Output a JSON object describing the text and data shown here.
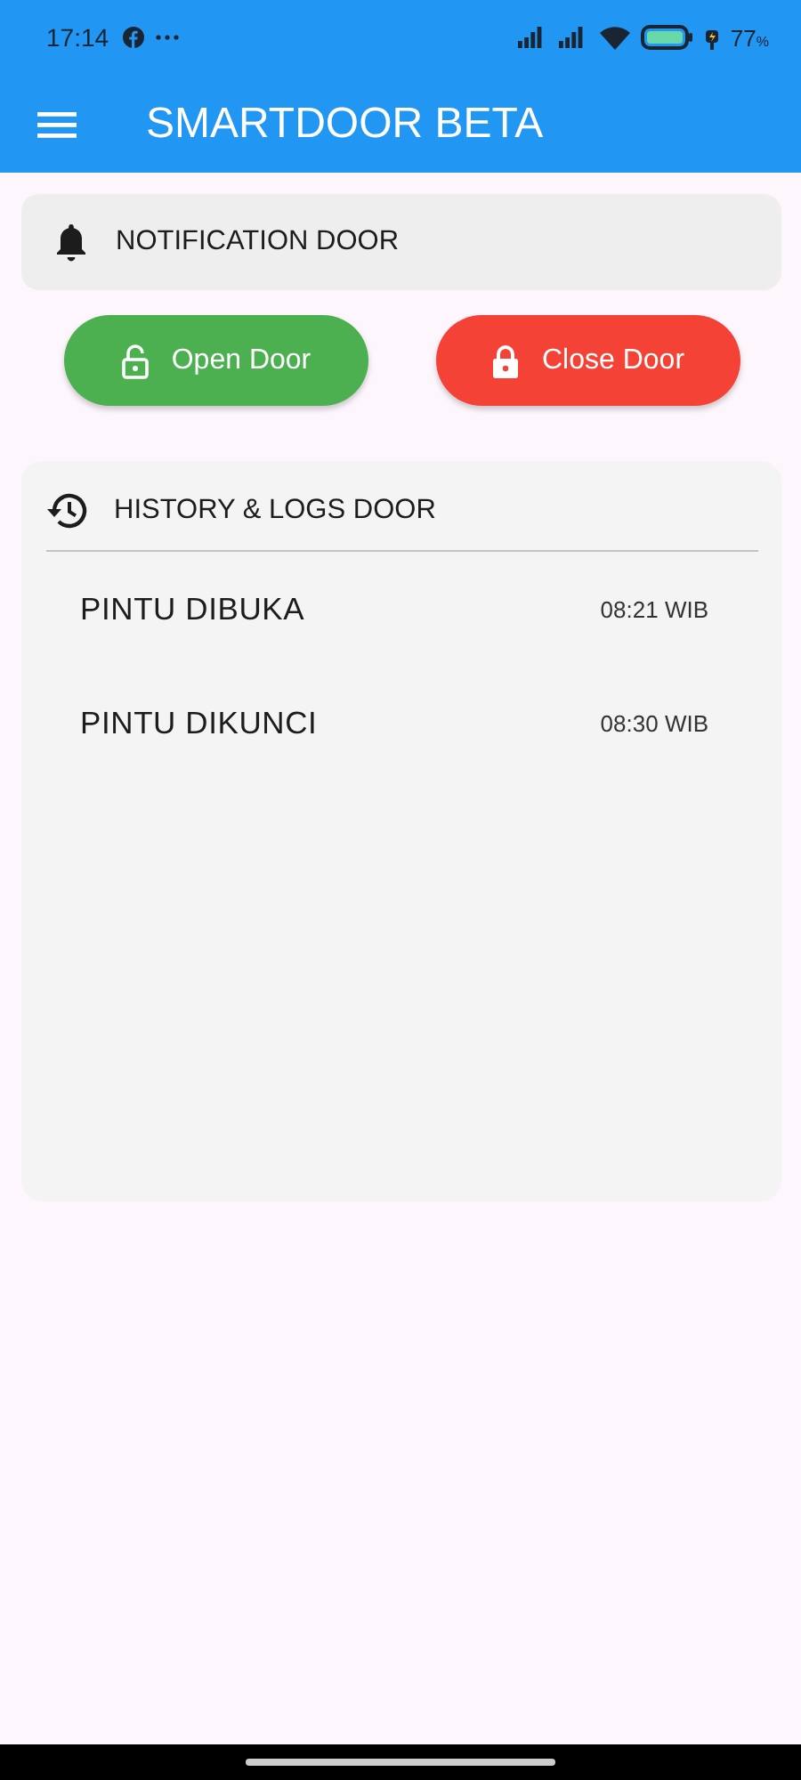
{
  "status_bar": {
    "time": "17:14",
    "battery": "77",
    "battery_unit": "%"
  },
  "app_bar": {
    "title": "SMARTDOOR BETA"
  },
  "notification": {
    "title": "NOTIFICATION DOOR"
  },
  "buttons": [
    {
      "label": "Open Door",
      "kind": "open"
    },
    {
      "label": "Close Door",
      "kind": "close"
    }
  ],
  "history": {
    "title": "HISTORY & LOGS DOOR",
    "logs": [
      {
        "event": "PINTU DIBUKA",
        "time": "08:21 WIB"
      },
      {
        "event": "PINTU DIKUNCI",
        "time": "08:30 WIB"
      }
    ]
  }
}
